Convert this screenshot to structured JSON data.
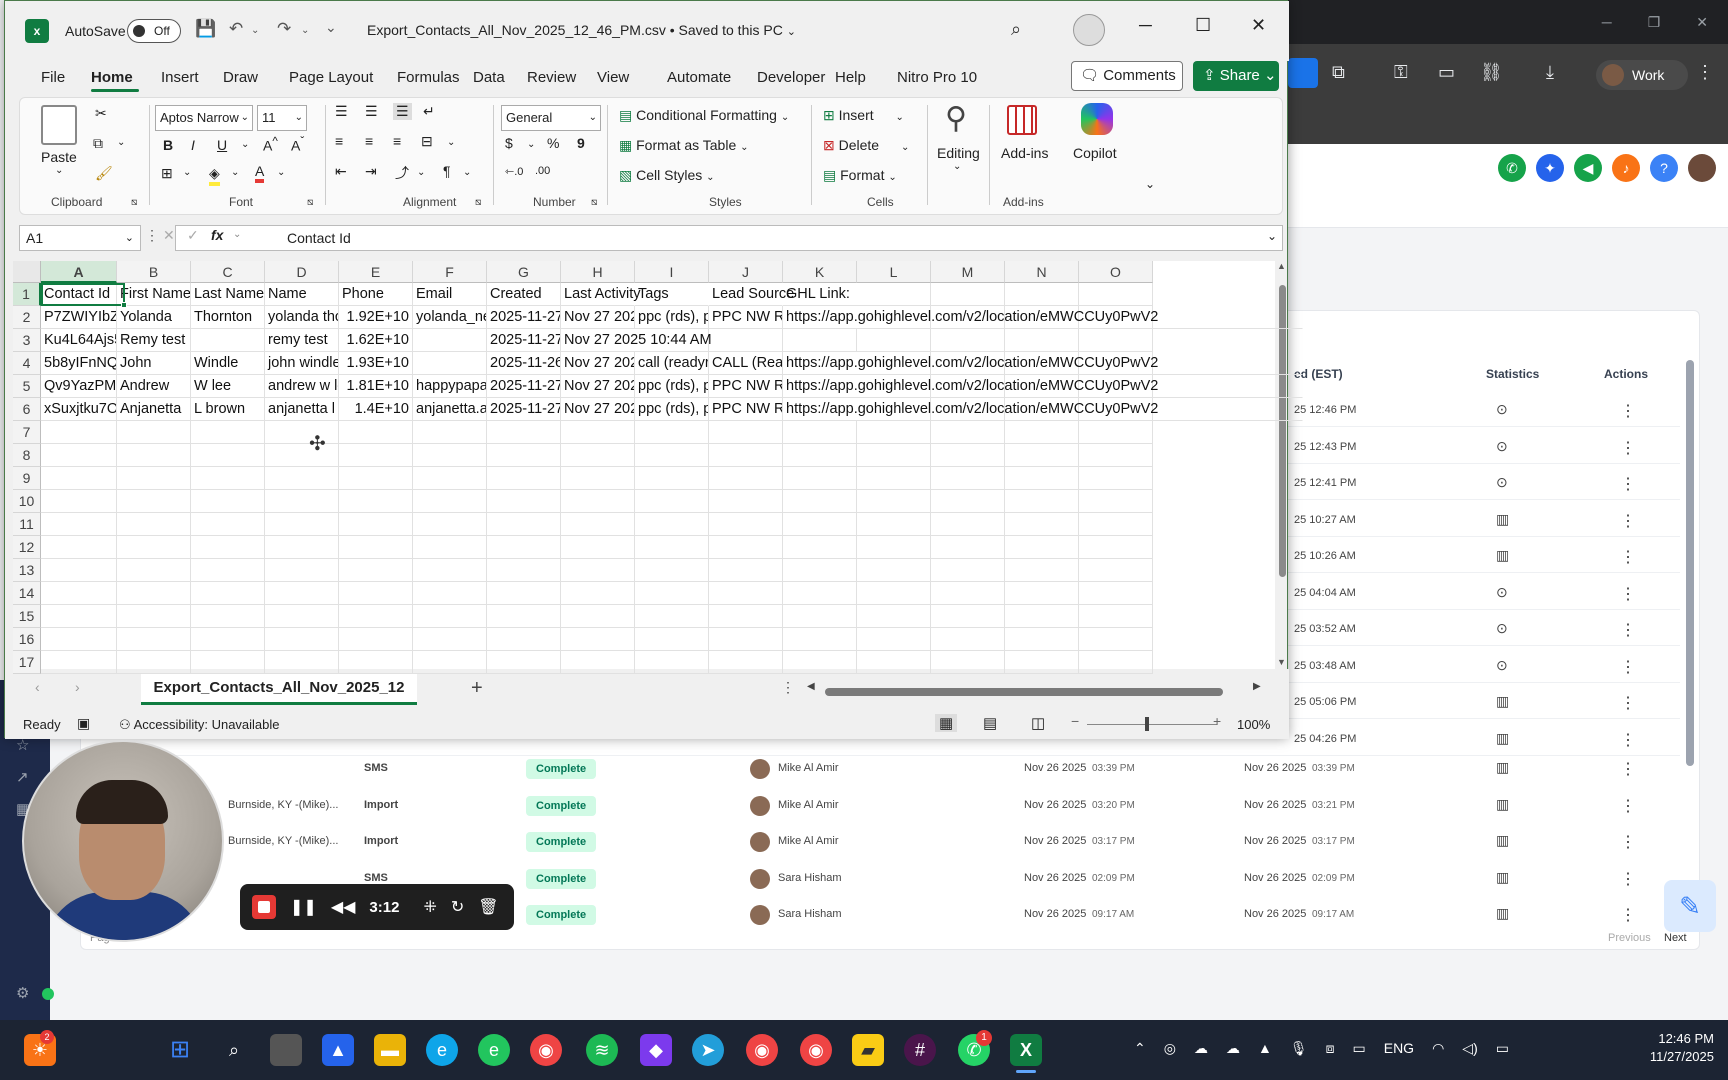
{
  "excel": {
    "autosave_label": "AutoSave",
    "autosave_state": "Off",
    "doc_title": "Export_Contacts_All_Nov_2025_12_46_PM.csv • Saved to this PC",
    "menus": [
      "File",
      "Home",
      "Insert",
      "Draw",
      "Page Layout",
      "Formulas",
      "Data",
      "Review",
      "View",
      "Automate",
      "Developer",
      "Help",
      "Nitro Pro 10"
    ],
    "comments": "Comments",
    "share": "Share",
    "ribbon": {
      "paste": "Paste",
      "font_name": "Aptos Narrow",
      "font_size": "11",
      "number_format": "General",
      "conditional_formatting": "Conditional Formatting",
      "format_as_table": "Format as Table",
      "cell_styles": "Cell Styles",
      "insert": "Insert",
      "delete": "Delete",
      "format": "Format",
      "editing": "Editing",
      "addins": "Add-ins",
      "copilot": "Copilot",
      "groups": {
        "clipboard": "Clipboard",
        "font": "Font",
        "alignment": "Alignment",
        "number": "Number",
        "styles": "Styles",
        "cells": "Cells",
        "addins": "Add-ins"
      }
    },
    "name_box": "A1",
    "formula": "Contact Id",
    "columns": [
      "A",
      "B",
      "C",
      "D",
      "E",
      "F",
      "G",
      "H",
      "I",
      "J",
      "K",
      "L",
      "M",
      "N",
      "O"
    ],
    "rows": [
      "1",
      "2",
      "3",
      "4",
      "5",
      "6",
      "7",
      "8",
      "9",
      "10",
      "11",
      "12",
      "13",
      "14",
      "15",
      "16",
      "17"
    ],
    "cells": [
      [
        "Contact Id",
        "First Name",
        "Last Name",
        "Name",
        "Phone",
        "Email",
        "Created",
        "Last Activity",
        "Tags",
        "Lead Source",
        "GHL Link:"
      ],
      [
        "P7ZWIYIbZc",
        "Yolanda",
        "Thornton",
        "yolanda thc",
        "1.92E+10",
        "yolanda_ne",
        "2025-11-27",
        "Nov 27 202",
        "ppc (rds), p",
        "PPC NW RD",
        "https://app.gohighlevel.com/v2/location/eMWCCUy0PwV2"
      ],
      [
        "Ku4L64Ajs5",
        "Remy test",
        "",
        "remy test",
        "1.62E+10",
        "",
        "2025-11-27",
        "Nov 27 2025 10:44 AM",
        "",
        "",
        ""
      ],
      [
        "5b8yIFnNQ",
        "John",
        "Windle",
        "john windle",
        "1.93E+10",
        "",
        "2025-11-26",
        "Nov 27 202",
        "call (readyr",
        "CALL (Read",
        "https://app.gohighlevel.com/v2/location/eMWCCUy0PwV2"
      ],
      [
        "Qv9YazPMF",
        "Andrew",
        "W lee",
        "andrew w le",
        "1.81E+10",
        "happypapa",
        "2025-11-27",
        "Nov 27 202",
        "ppc (rds), p",
        "PPC NW RD",
        "https://app.gohighlevel.com/v2/location/eMWCCUy0PwV2"
      ],
      [
        "xSuxjtku7O",
        "Anjanetta",
        "L brown",
        "anjanetta l",
        "1.4E+10",
        "anjanetta.a",
        "2025-11-27",
        "Nov 27 202",
        "ppc (rds), p",
        "PPC NW RD",
        "https://app.gohighlevel.com/v2/location/eMWCCUy0PwV2"
      ]
    ],
    "sheet_tab": "Export_Contacts_All_Nov_2025_12",
    "status": "Ready",
    "accessibility": "Accessibility: Unavailable",
    "zoom": "100%"
  },
  "browser": {
    "work": "Work",
    "table_headers": {
      "created": "ed (EST)",
      "statistics": "Statistics",
      "actions": "Actions"
    },
    "rows": [
      {
        "date": "25 12:46 PM",
        "stat": "download"
      },
      {
        "date": "25 12:43 PM",
        "stat": "download"
      },
      {
        "date": "25 12:41 PM",
        "stat": "download"
      },
      {
        "date": "25 10:27 AM",
        "stat": "chart"
      },
      {
        "date": "25 10:26 AM",
        "stat": "chart"
      },
      {
        "date": "25 04:04 AM",
        "stat": "download"
      },
      {
        "date": "25 03:52 AM",
        "stat": "download"
      },
      {
        "date": "25 03:48 AM",
        "stat": "download"
      },
      {
        "date": "25 05:06 PM",
        "stat": "chart"
      },
      {
        "date": "25 04:26 PM",
        "stat": "chart"
      }
    ],
    "lower_rows": [
      {
        "loc": "",
        "type": "SMS",
        "status": "Complete",
        "user": "Mike Al Amir",
        "d1": "Nov 26 2025",
        "t1": "03:39 PM",
        "d2": "Nov 26 2025",
        "t2": "03:39 PM"
      },
      {
        "loc": "Burnside, KY -(Mike)...",
        "type": "Import",
        "status": "Complete",
        "user": "Mike Al Amir",
        "d1": "Nov 26 2025",
        "t1": "03:20 PM",
        "d2": "Nov 26 2025",
        "t2": "03:21 PM"
      },
      {
        "loc": "Burnside, KY -(Mike)...",
        "type": "Import",
        "status": "Complete",
        "user": "Mike Al Amir",
        "d1": "Nov 26 2025",
        "t1": "03:17 PM",
        "d2": "Nov 26 2025",
        "t2": "03:17 PM"
      },
      {
        "loc": "",
        "type": "SMS",
        "status": "Complete",
        "user": "Sara Hisham",
        "d1": "Nov 26 2025",
        "t1": "02:09 PM",
        "d2": "Nov 26 2025",
        "t2": "02:09 PM"
      },
      {
        "loc": "",
        "type": "SMS",
        "status": "Complete",
        "user": "Sara Hisham",
        "d1": "Nov 26 2025",
        "t1": "09:17 AM",
        "d2": "Nov 26 2025",
        "t2": "09:17 AM"
      }
    ],
    "page_label": "Page 1",
    "previous": "Previous",
    "next": "Next"
  },
  "recorder": {
    "time": "3:12"
  },
  "taskbar": {
    "lang": "ENG",
    "time": "12:46 PM",
    "date": "11/27/2025",
    "badge1": "2",
    "badge2": "1"
  },
  "colors": {
    "excel_green": "#107c41",
    "complete_bg": "#d1fae5",
    "taskbar": "#1c2433"
  }
}
